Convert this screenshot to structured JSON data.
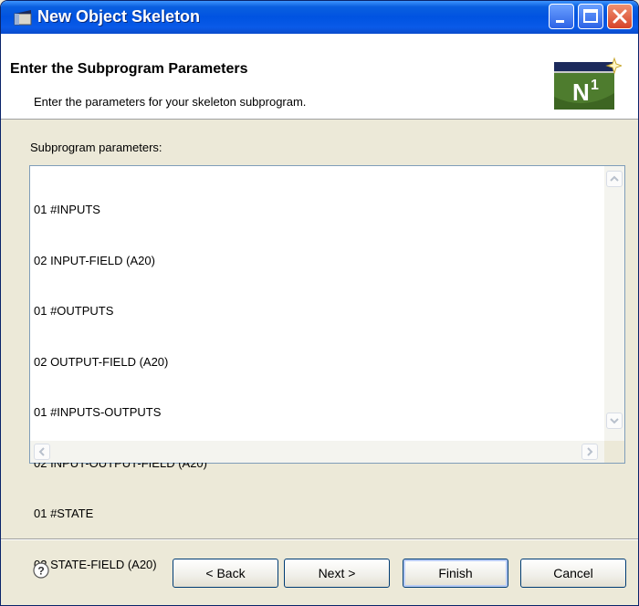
{
  "window": {
    "title": "New Object Skeleton"
  },
  "header": {
    "title": "Enter the Subprogram Parameters",
    "description": "Enter the parameters for your skeleton subprogram.",
    "logo": {
      "text": "N",
      "superscript": "1"
    }
  },
  "params": {
    "label": "Subprogram parameters:",
    "lines": [
      "01 #INPUTS",
      "02 INPUT-FIELD (A20)",
      "01 #OUTPUTS",
      "02 OUTPUT-FIELD (A20)",
      "01 #INPUTS-OUTPUTS",
      "02 INPUT-OUTPUT-FIELD (A20)",
      "01 #STATE",
      "02 STATE-FIELD (A20)"
    ]
  },
  "buttons": {
    "back": "< Back",
    "next": "Next >",
    "finish": "Finish",
    "cancel": "Cancel"
  },
  "icons": {
    "app": "window-app-icon",
    "help": "help-icon",
    "minimize": "minimize-icon",
    "maximize": "maximize-icon",
    "close": "close-icon"
  },
  "colors": {
    "titlebar": "#0053e1",
    "dialog_bg": "#ece9d8",
    "close": "#d6432a",
    "logo_green": "#4e7c2e",
    "logo_navy": "#1c2a5c"
  }
}
